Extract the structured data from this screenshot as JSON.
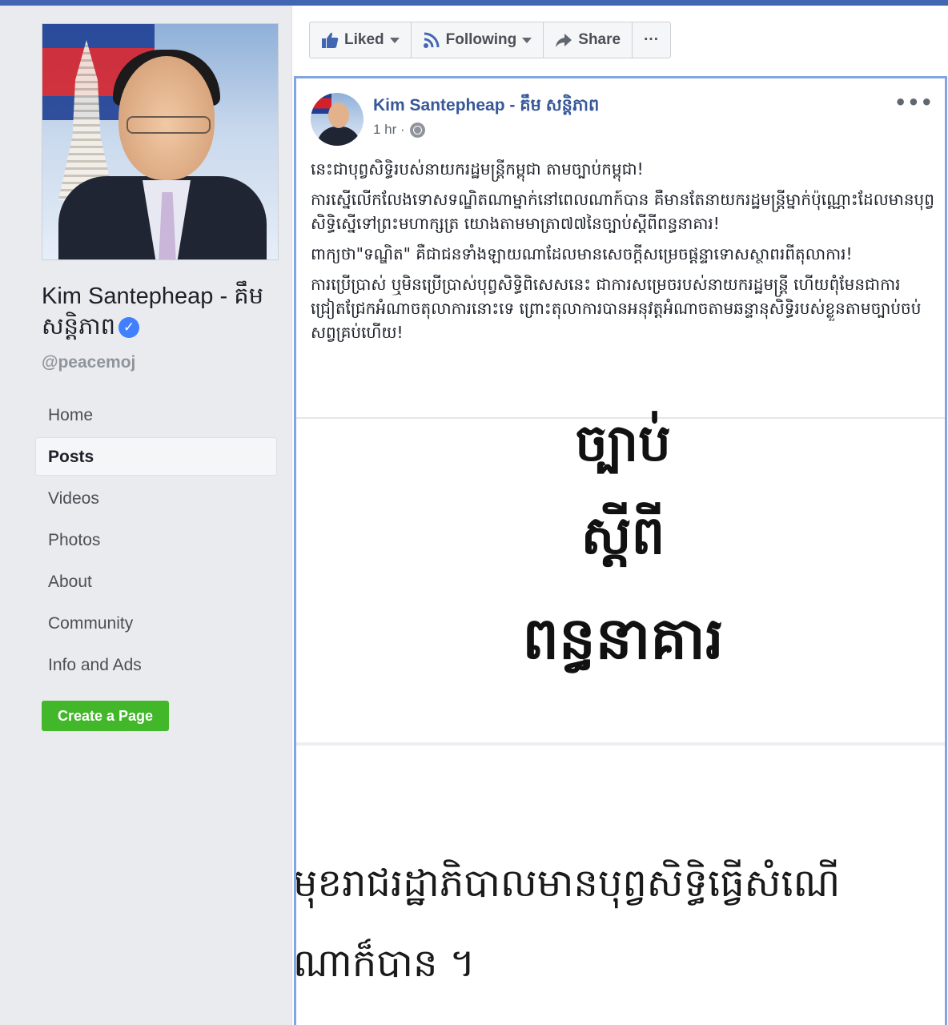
{
  "page": {
    "name": "Kim Santepheap - គឹម សន្តិភាព",
    "handle": "@peacemoj",
    "verified_symbol": "✓"
  },
  "nav": {
    "items": [
      {
        "label": "Home",
        "active": false
      },
      {
        "label": "Posts",
        "active": true
      },
      {
        "label": "Videos",
        "active": false
      },
      {
        "label": "Photos",
        "active": false
      },
      {
        "label": "About",
        "active": false
      },
      {
        "label": "Community",
        "active": false
      },
      {
        "label": "Info and Ads",
        "active": false
      }
    ]
  },
  "create_page_label": "Create a Page",
  "actions": {
    "liked": "Liked",
    "following": "Following",
    "share": "Share",
    "more": "···"
  },
  "post": {
    "author": "Kim Santepheap - គឹម សន្តិភាព",
    "time": "1 hr ·",
    "more": "•••",
    "paragraphs": [
      "នេះជាបុព្វសិទ្ធិរបស់នាយករដ្ឋមន្ត្រីកម្ពុជា តាមច្បាប់កម្ពុជា!",
      "ការស្នើលើកលែងទោសទណ្ឌិតណាម្នាក់នៅពេលណាក៍បាន គឺមានតែនាយករដ្ឋមន្ត្រីម្នាក់ប៉ុណ្ណោះដែលមានបុព្វសិទ្ធិស្នើទៅព្រះមហាក្សត្រ យោងតាមមាត្រា៧៧នៃច្បាប់ស្តីពីពន្ធនាគារ!",
      "ពាក្យថា\"ទណ្ឌិត\" គឺជាជនទាំងឡាយណាដែលមានសេចក្តីសម្រេចផ្តន្ទាទោសស្ថាពរពីតុលាការ!",
      "ការប្រើប្រាស់ ឬមិនប្រើប្រាស់បុព្វសិទ្ធិពិសេសនេះ ជាការសម្រេចរបស់នាយករដ្ឋមន្ត្រី ហើយពុំមែនជាការជ្រៀតជ្រែកអំណាចតុលាការនោះទេ ព្រោះតុលាការបានអនុវត្តអំណាចតាមឆន្ទានុសិទ្ធិរបស់ខ្លួនតាមច្បាប់ចប់សព្វគ្រប់ហើយ!"
    ],
    "image1_words": [
      "ច្បាប់",
      "ស្តីពី",
      "ពន្ធនាគារ"
    ],
    "image2_lines": [
      "មុខរាជរដ្ឋាភិបាលមានបុព្វសិទ្ធិធ្វើសំណើ",
      "ណាក៏បាន ។"
    ]
  },
  "colors": {
    "brand_blue": "#4267b2",
    "link_blue": "#385898",
    "create_green": "#42b72a",
    "highlight_border": "#7fa6de"
  }
}
